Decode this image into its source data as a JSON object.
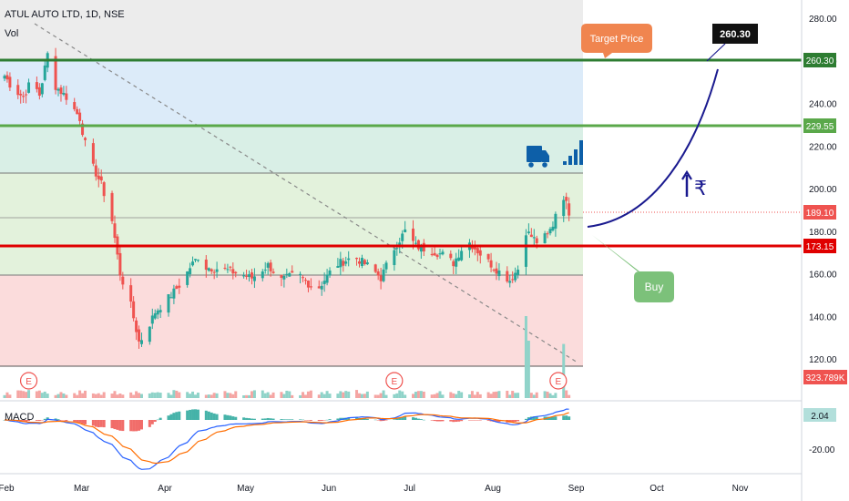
{
  "header": {
    "title": "ATUL AUTO LTD, 1D, NSE",
    "vol_label": "Vol"
  },
  "macd": {
    "label": "MACD",
    "value": "2.04",
    "ticks": [
      "-20.00"
    ]
  },
  "annotations": {
    "target_callout": "Target Price",
    "target_value": "260.30",
    "buy_callout": "Buy",
    "rupee_symbol": "₹",
    "earnings_marker": "E",
    "earnings_dates": [
      "2023-02-10",
      "2023-06-26",
      "2023-08-26"
    ]
  },
  "price_badges": {
    "r2": "260.30",
    "r1": "229.55",
    "last": "189.10",
    "support": "173.15",
    "volume": "323.789K"
  },
  "colors": {
    "up": "#26a69a",
    "down": "#ef5350",
    "resistance": "#2e7d32",
    "resistance_light": "#5aa84a",
    "support": "#e00000",
    "arrow": "#1a1a8f",
    "truck": "#0d5fa8",
    "callout_orange": "#f0854f",
    "callout_green": "#7cc17a",
    "macd_line": "#2962ff",
    "signal_line": "#ff6d00"
  },
  "chart_data": {
    "type": "candlestick",
    "title": "ATUL AUTO LTD, 1D, NSE",
    "x_ticks": [
      "Feb",
      "Mar",
      "Apr",
      "May",
      "Jun",
      "Jul",
      "Aug",
      "Sep",
      "Oct",
      "Nov"
    ],
    "x_range": [
      "2023-02-01",
      "2023-11-12"
    ],
    "y_ticks": [
      "280.00",
      "260.00",
      "240.00",
      "220.00",
      "200.00",
      "180.00",
      "160.00",
      "140.00",
      "120.00"
    ],
    "ylim": [
      112,
      290
    ],
    "grid": false,
    "levels": [
      {
        "label": "260.30",
        "value": 260.3
      },
      {
        "label": "229.55",
        "value": 229.55
      },
      {
        "label": "173.15",
        "value": 173.15
      }
    ],
    "zone_boundaries": [
      260.3,
      229.55,
      207,
      189.1,
      173.15,
      159,
      118
    ],
    "last_price": 189.1,
    "projection": {
      "from": [
        "2023-08-31",
        181
      ],
      "to": [
        "2023-10-16",
        257
      ]
    },
    "ohlc_knots": [
      [
        "2023-02-01",
        253
      ],
      [
        "2023-02-04",
        247
      ],
      [
        "2023-02-08",
        243
      ],
      [
        "2023-02-11",
        251
      ],
      [
        "2023-02-14",
        244
      ],
      [
        "2023-02-17",
        263
      ],
      [
        "2023-02-20",
        248
      ],
      [
        "2023-02-24",
        243
      ],
      [
        "2023-03-01",
        233
      ],
      [
        "2023-03-04",
        215
      ],
      [
        "2023-03-09",
        202
      ],
      [
        "2023-03-13",
        185
      ],
      [
        "2023-03-16",
        160
      ],
      [
        "2023-03-20",
        145
      ],
      [
        "2023-03-23",
        128
      ],
      [
        "2023-03-25",
        131
      ],
      [
        "2023-03-29",
        142
      ],
      [
        "2023-04-04",
        150
      ],
      [
        "2023-04-08",
        156
      ],
      [
        "2023-04-11",
        163
      ],
      [
        "2023-04-14",
        168
      ],
      [
        "2023-04-17",
        163
      ],
      [
        "2023-04-24",
        162
      ],
      [
        "2023-05-04",
        158
      ],
      [
        "2023-05-10",
        164
      ],
      [
        "2023-05-15",
        157
      ],
      [
        "2023-05-21",
        160
      ],
      [
        "2023-05-28",
        152
      ],
      [
        "2023-06-04",
        164
      ],
      [
        "2023-06-11",
        168
      ],
      [
        "2023-06-17",
        163
      ],
      [
        "2023-06-21",
        158
      ],
      [
        "2023-06-26",
        172
      ],
      [
        "2023-06-30",
        180
      ],
      [
        "2023-07-04",
        173
      ],
      [
        "2023-07-09",
        171
      ],
      [
        "2023-07-14",
        169
      ],
      [
        "2023-07-18",
        165
      ],
      [
        "2023-07-23",
        176
      ],
      [
        "2023-07-29",
        168
      ],
      [
        "2023-08-03",
        162
      ],
      [
        "2023-08-08",
        157
      ],
      [
        "2023-08-12",
        164
      ],
      [
        "2023-08-14",
        180
      ],
      [
        "2023-08-18",
        175
      ],
      [
        "2023-08-22",
        178
      ],
      [
        "2023-08-24",
        183
      ],
      [
        "2023-08-27",
        200
      ],
      [
        "2023-08-30",
        189
      ]
    ],
    "volume_spikes": [
      [
        "2023-07-23",
        0.33
      ],
      [
        "2023-08-14",
        0.5
      ],
      [
        "2023-08-15",
        0.35
      ],
      [
        "2023-08-27",
        0.58
      ],
      [
        "2023-08-28",
        0.33
      ]
    ]
  }
}
